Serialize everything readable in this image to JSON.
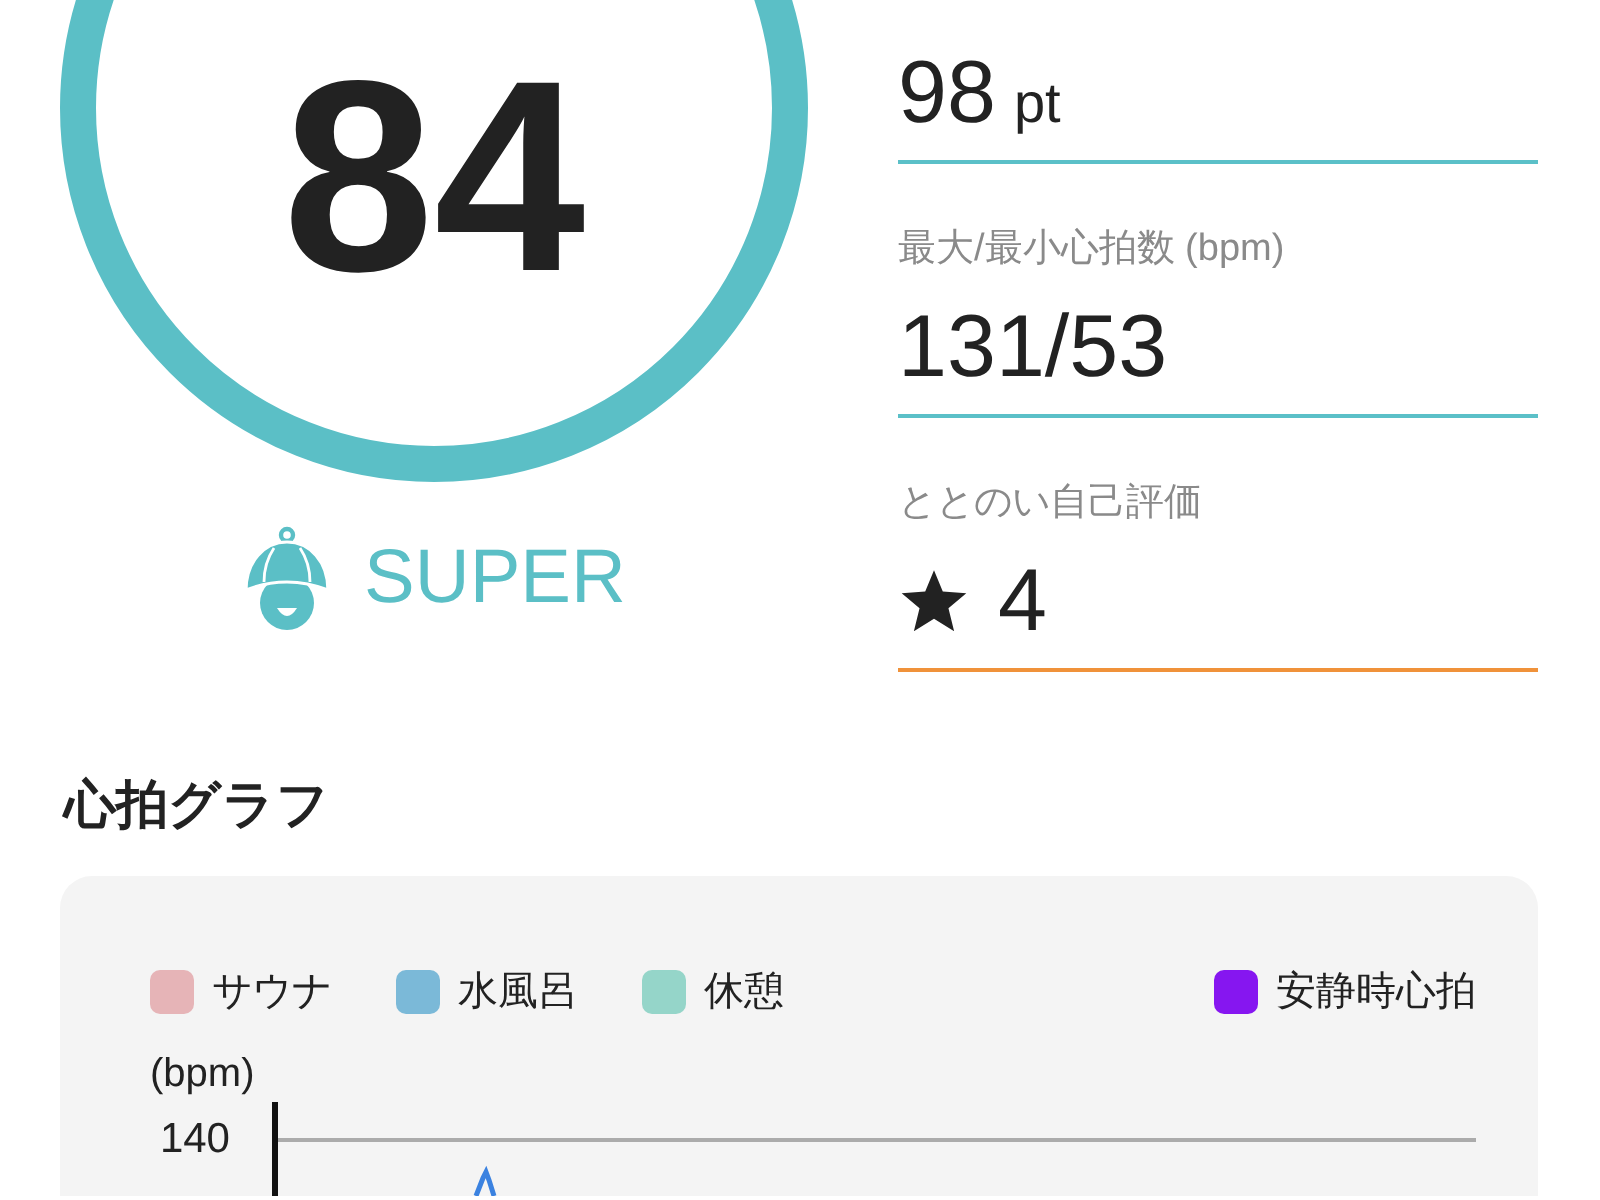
{
  "score": {
    "value": "84",
    "rank": "SUPER"
  },
  "metrics": [
    {
      "kind": "number",
      "value": "98",
      "unit": "pt",
      "color": "#5bc0c8"
    },
    {
      "kind": "number",
      "label": "最大/最小心拍数 (bpm)",
      "value": "131/53",
      "color": "#5bc0c8"
    },
    {
      "kind": "rating",
      "label": "ととのい自己評価",
      "value": "4",
      "color": "#f0923a"
    }
  ],
  "heart_rate_graph": {
    "title": "心拍グラフ",
    "legend": [
      {
        "label": "サウナ",
        "color": "#e6b4b7"
      },
      {
        "label": "水風呂",
        "color": "#7bb9d8"
      },
      {
        "label": "休憩",
        "color": "#95d5c9"
      },
      {
        "label": "安静時心拍",
        "color": "#8616f0"
      }
    ],
    "y_unit": "(bpm)",
    "y_ticks": [
      "140"
    ]
  }
}
